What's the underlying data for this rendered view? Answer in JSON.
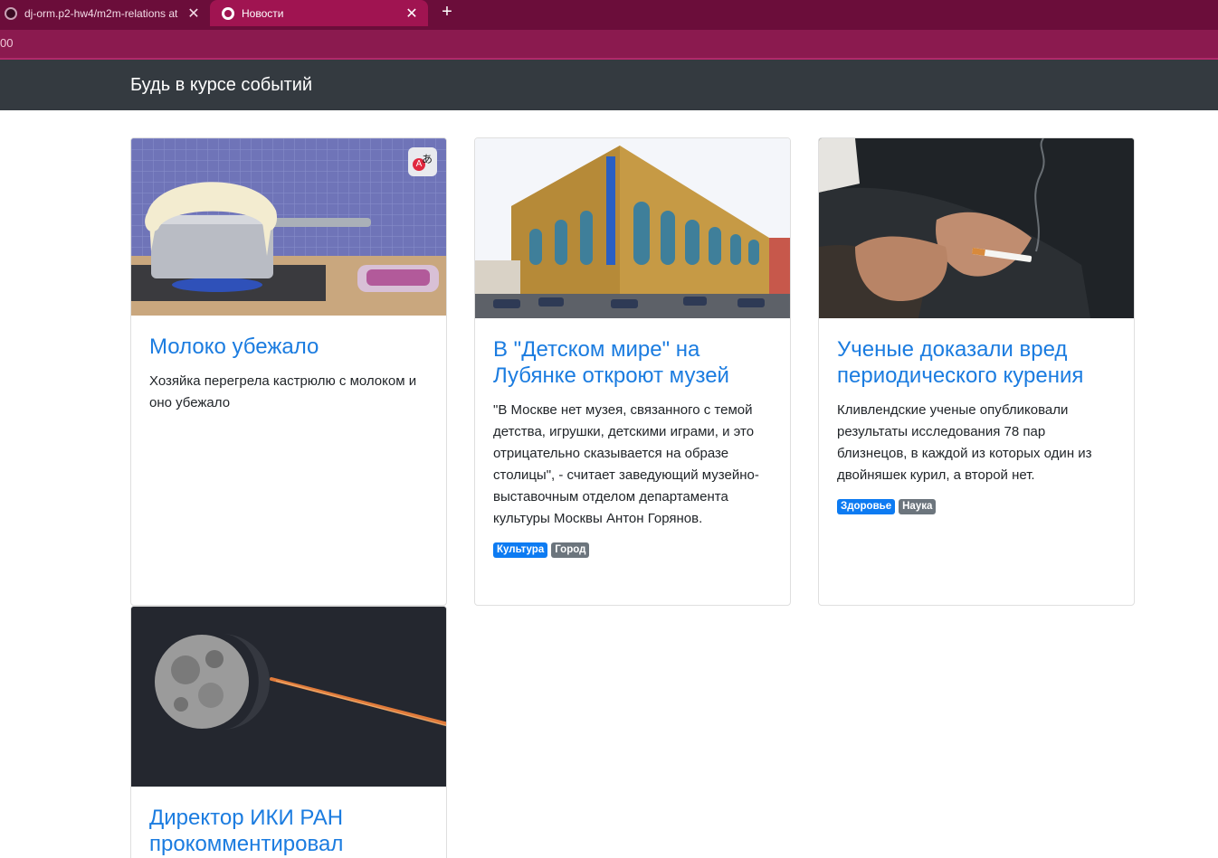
{
  "browser": {
    "tabs": [
      {
        "title": "dj-orm.p2-hw4/m2m-relations at",
        "close": "✕"
      },
      {
        "title": "Новости",
        "close": "✕"
      }
    ],
    "new_tab": "+",
    "url": "00"
  },
  "navbar": {
    "brand": "Будь в курсе событий"
  },
  "articles": [
    {
      "title": "Молоко убежало",
      "text": "Хозяйка перегрела кастрюлю с молоком и оно убежало",
      "tags": []
    },
    {
      "title": "В \"Детском мире\" на Лубянке откроют музей",
      "text": "\"В Москве нет музея, связанного с темой детства, игрушки, детскими играми, и это отрицательно сказывается на образе столицы\", - считает заведующий музейно-выставочным отделом департамента культуры Москвы Антон Горянов.",
      "tags": [
        {
          "label": "Культура",
          "color": "#0d7bf2"
        },
        {
          "label": "Город",
          "color": "#6c757d"
        }
      ]
    },
    {
      "title": "Ученые доказали вред периодического курения",
      "text": "Кливлендские ученые опубликовали результаты исследования 78 пар близнецов, в каждой из которых один из двойняшек курил, а второй нет.",
      "tags": [
        {
          "label": "Здоровье",
          "color": "#0d7bf2"
        },
        {
          "label": "Наука",
          "color": "#6c757d"
        }
      ]
    },
    {
      "title": "Директор ИКИ РАН прокомментировал",
      "text": "",
      "tags": []
    }
  ],
  "colors": {
    "tabbar": "#6b0d3a",
    "active_tab": "#a01451",
    "addressbar": "#8b1a4f",
    "navbar": "#343a40",
    "link": "#1b7ce0"
  }
}
